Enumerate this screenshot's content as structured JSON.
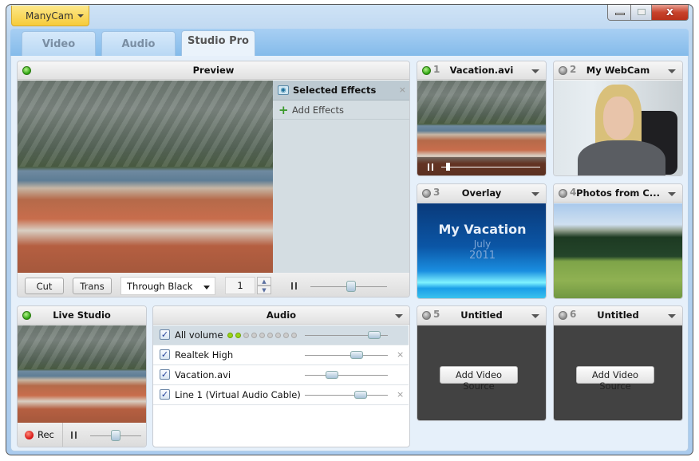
{
  "app": {
    "menu_label": "ManyCam",
    "close_label": "x"
  },
  "tabs": [
    {
      "label": "Video"
    },
    {
      "label": "Audio"
    },
    {
      "label": "Studio Pro"
    }
  ],
  "preview": {
    "title": "Preview",
    "effects": {
      "title": "Selected Effects",
      "add_label": "Add Effects"
    },
    "controls": {
      "cut_label": "Cut",
      "trans_label": "Trans",
      "transition_value": "Through Black",
      "spin_value": "1",
      "speed_level_percent": 53
    }
  },
  "live_studio": {
    "title": "Live Studio",
    "rec_label": "Rec",
    "volume_percent": 50
  },
  "audio": {
    "title": "Audio",
    "all_volume": {
      "label": "All volume",
      "checked": true,
      "level_dots_lit": 2,
      "level_dots_total": 9,
      "volume_percent": 90
    },
    "rows": [
      {
        "label": "Realtek High",
        "checked": true,
        "volume_percent": 65,
        "removable": true
      },
      {
        "label": "Vacation.avi",
        "checked": true,
        "volume_percent": 30,
        "removable": false
      },
      {
        "label": "Line 1 (Virtual Audio Cable)",
        "checked": true,
        "volume_percent": 70,
        "removable": true
      }
    ]
  },
  "sources": [
    {
      "num": "1",
      "title": "Vacation.avi",
      "status": "active",
      "type": "video",
      "playback_percent": 5
    },
    {
      "num": "2",
      "title": "My WebCam",
      "status": "inactive",
      "type": "webcam"
    },
    {
      "num": "3",
      "title": "Overlay",
      "status": "inactive",
      "type": "overlay",
      "overlay_title": "My Vacation",
      "overlay_line2": "July",
      "overlay_line3": "2011"
    },
    {
      "num": "4",
      "title": "Photos from C...",
      "status": "inactive",
      "type": "photos"
    },
    {
      "num": "5",
      "title": "Untitled",
      "status": "inactive",
      "type": "empty",
      "button": "Add Video Source"
    },
    {
      "num": "6",
      "title": "Untitled",
      "status": "inactive",
      "type": "empty",
      "button": "Add Video Source"
    }
  ],
  "colors": {
    "active_dot": "#2aa30e",
    "app_button": "#f6cb3a",
    "close_button": "#c8432c"
  }
}
